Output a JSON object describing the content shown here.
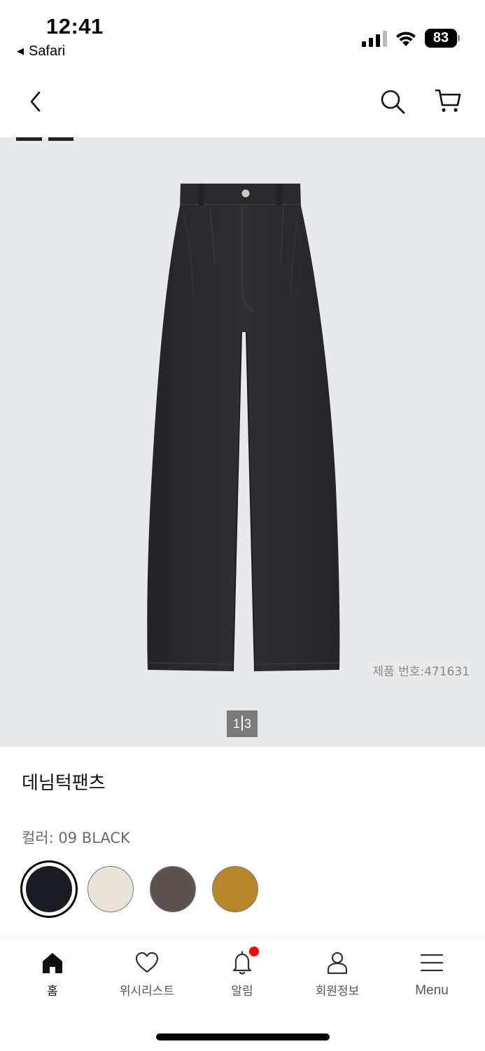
{
  "status_bar": {
    "time": "12:41",
    "back_app": "Safari",
    "battery": "83",
    "icons": [
      "cellular-signal-icon",
      "wifi-icon",
      "battery-icon"
    ]
  },
  "header": {
    "back_icon": "chevron-left-icon",
    "search_icon": "search-icon",
    "cart_icon": "cart-icon"
  },
  "gallery": {
    "product_number": "제품 번호:471631",
    "pager_current": "1",
    "pager_total": "3",
    "background": "#e8e9eb",
    "garment_color": "#2b2b2d"
  },
  "product": {
    "name": "데님턱팬츠",
    "color_label": "컬러: 09 BLACK",
    "swatches": [
      {
        "color": "#1b1c21",
        "selected": true
      },
      {
        "color": "#e8e4da",
        "selected": false
      },
      {
        "color": "#5e5250",
        "selected": false
      },
      {
        "color": "#b8872a",
        "selected": false
      }
    ]
  },
  "tab_bar": {
    "tabs": [
      {
        "label": "홈",
        "icon": "home-icon",
        "active": true
      },
      {
        "label": "위시리스트",
        "icon": "heart-icon",
        "active": false
      },
      {
        "label": "알림",
        "icon": "bell-icon",
        "active": false,
        "notification_dot": true
      },
      {
        "label": "회원정보",
        "icon": "user-icon",
        "active": false
      },
      {
        "label": "Menu",
        "icon": "hamburger-menu-icon",
        "active": false
      }
    ]
  },
  "colors": {
    "notification": "#ff0000",
    "pager_bg": "#7a7a7a"
  }
}
